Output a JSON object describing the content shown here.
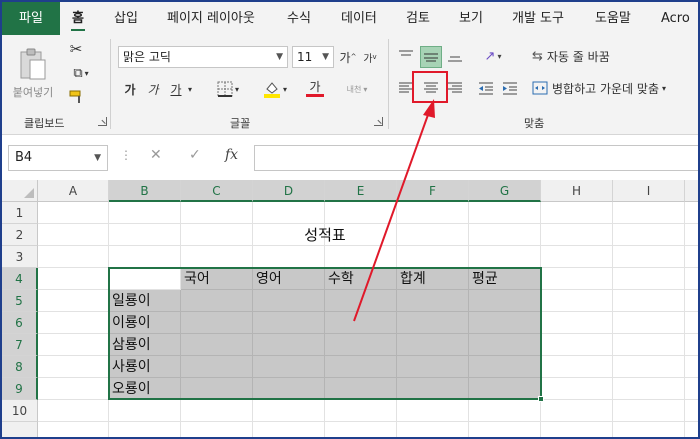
{
  "ribbon_tabs": [
    {
      "label": "파일"
    },
    {
      "label": "홈"
    },
    {
      "label": "삽입"
    },
    {
      "label": "페이지 레이아웃"
    },
    {
      "label": "수식"
    },
    {
      "label": "데이터"
    },
    {
      "label": "검토"
    },
    {
      "label": "보기"
    },
    {
      "label": "개발 도구"
    },
    {
      "label": "도움말"
    },
    {
      "label": "Acro"
    }
  ],
  "clipboard": {
    "paste_label": "붙여넣기",
    "group_label": "클립보드"
  },
  "font": {
    "name": "맑은 고딕",
    "size": "11",
    "group_label": "글꼴",
    "bold": "가",
    "italic": "가",
    "underline": "가",
    "font_color_glyph": "가",
    "phonetic_glyph": "내천"
  },
  "alignment": {
    "wrap_text": "자동 줄 바꿈",
    "merge_center": "병합하고 가운데 맞춤",
    "group_label": "맞춤"
  },
  "colors": {
    "accent": "#217346",
    "annotation": "#e0192a",
    "selection_fill": "#c8c8c8"
  },
  "formula_bar": {
    "name_box": "B4",
    "fx_label": "fx",
    "formula": ""
  },
  "columns": [
    "A",
    "B",
    "C",
    "D",
    "E",
    "F",
    "G",
    "H",
    "I"
  ],
  "rows": [
    "1",
    "2",
    "3",
    "4",
    "5",
    "6",
    "7",
    "8",
    "9",
    "10"
  ],
  "sheet": {
    "title": "성적표",
    "headers": [
      "국어",
      "영어",
      "수학",
      "합계",
      "평균"
    ],
    "names": [
      "일룡이",
      "이룡이",
      "삼룡이",
      "사룡이",
      "오룡이"
    ]
  }
}
